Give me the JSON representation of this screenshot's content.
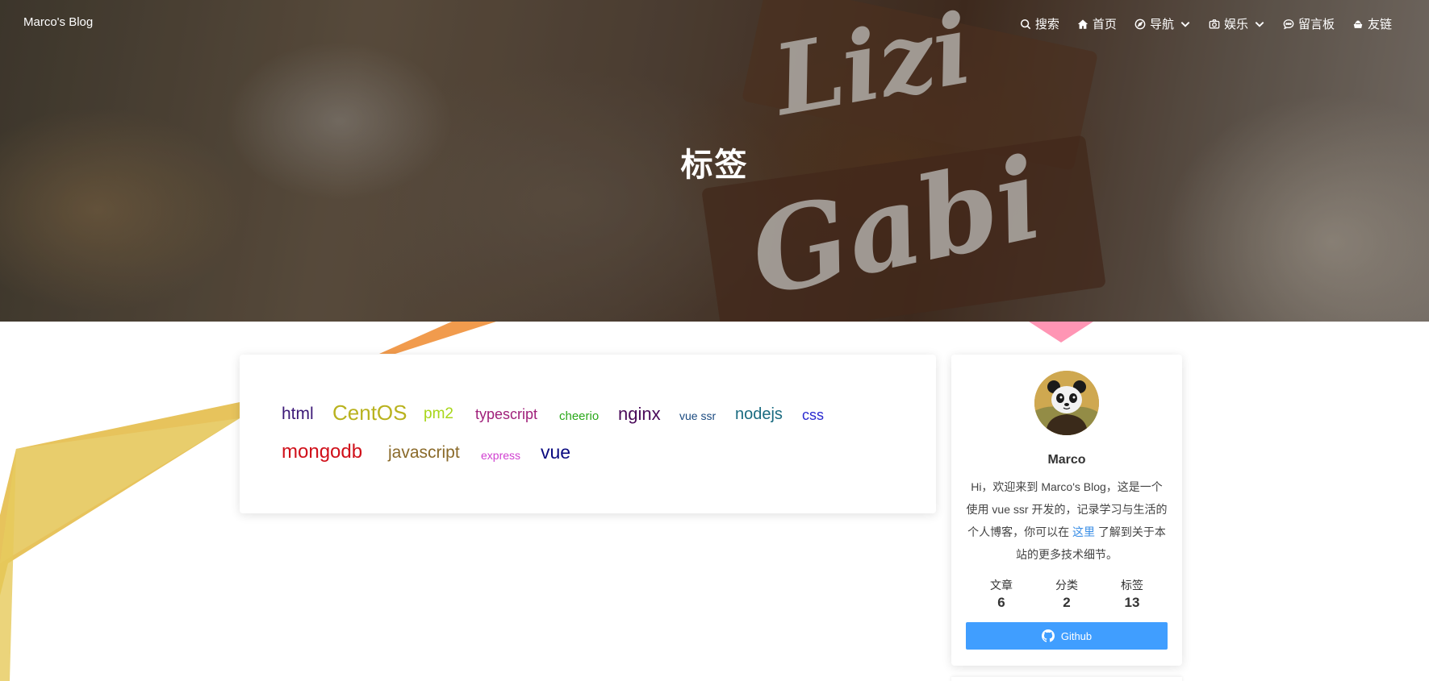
{
  "header": {
    "brand": "Marco's Blog",
    "nav": [
      {
        "label": "搜索",
        "icon": "search-icon",
        "dropdown": false
      },
      {
        "label": "首页",
        "icon": "home-icon",
        "dropdown": false
      },
      {
        "label": "导航",
        "icon": "compass-icon",
        "dropdown": true
      },
      {
        "label": "娱乐",
        "icon": "camera-icon",
        "dropdown": true
      },
      {
        "label": "留言板",
        "icon": "chat-icon",
        "dropdown": false
      },
      {
        "label": "友链",
        "icon": "link-icon",
        "dropdown": false
      }
    ]
  },
  "page": {
    "title": "标签"
  },
  "tags": [
    {
      "label": "html",
      "color": "#3d1a78"
    },
    {
      "label": "CentOS",
      "color": "#b9b21e"
    },
    {
      "label": "pm2",
      "color": "#a8d61a"
    },
    {
      "label": "typescript",
      "color": "#a0207a"
    },
    {
      "label": "cheerio",
      "color": "#2aa81a"
    },
    {
      "label": "nginx",
      "color": "#4a0a5a"
    },
    {
      "label": "vue ssr",
      "color": "#1a4a80"
    },
    {
      "label": "nodejs",
      "color": "#1a6b80"
    },
    {
      "label": "css",
      "color": "#2a2ad0"
    },
    {
      "label": "mongodb",
      "color": "#d0101a"
    },
    {
      "label": "javascript",
      "color": "#8a6a2a"
    },
    {
      "label": "express",
      "color": "#d040d0"
    },
    {
      "label": "vue",
      "color": "#0a0a80"
    }
  ],
  "profile": {
    "name": "Marco",
    "bio_before": "Hi，欢迎来到 Marco's Blog，这是一个使用 vue ssr 开发的，记录学习与生活的个人博客，你可以在 ",
    "bio_link": "这里",
    "bio_after": " 了解到关于本站的更多技术细节。",
    "stats": [
      {
        "label": "文章",
        "value": "6"
      },
      {
        "label": "分类",
        "value": "2"
      },
      {
        "label": "标签",
        "value": "13"
      }
    ],
    "github_label": "Github"
  }
}
